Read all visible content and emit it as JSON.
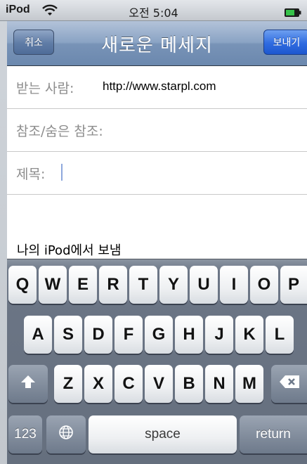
{
  "status_bar": {
    "carrier": "iPod",
    "time": "오전 5:04",
    "wifi_icon": "wifi-icon",
    "battery_icon": "battery-icon"
  },
  "nav": {
    "title": "새로운 메세지",
    "cancel_label": "취소",
    "send_label": "보내기"
  },
  "fields": {
    "to": {
      "label": "받는 사람:",
      "value": "http://www.starpl.com"
    },
    "cc": {
      "label": "참조/숨은 참조:"
    },
    "subject": {
      "label": "제목:"
    }
  },
  "body": {
    "signature": "나의 iPod에서 보냄"
  },
  "keyboard": {
    "row1": [
      "Q",
      "W",
      "E",
      "R",
      "T",
      "Y",
      "U",
      "I",
      "O",
      "P"
    ],
    "row2": [
      "A",
      "S",
      "D",
      "F",
      "G",
      "H",
      "J",
      "K",
      "L"
    ],
    "row3": [
      "Z",
      "X",
      "C",
      "V",
      "B",
      "N",
      "M"
    ],
    "numbers_label": "123",
    "space_label": "space",
    "return_label": "return",
    "shift_icon": "shift-arrow-icon",
    "globe_icon": "globe-icon",
    "delete_icon": "delete-backspace-icon"
  },
  "colors": {
    "navbar": "#7893b7",
    "send_button": "#2f6be0",
    "keyboard_bg": "#656f7e"
  }
}
